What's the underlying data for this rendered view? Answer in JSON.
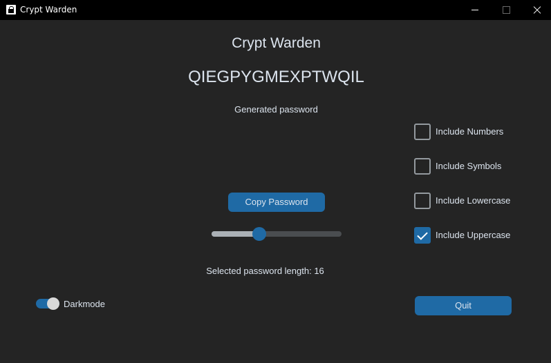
{
  "window": {
    "title": "Crypt Warden",
    "app_icon": "lock-person-icon",
    "controls": [
      "minimize-icon",
      "maximize-icon",
      "close-icon"
    ]
  },
  "main": {
    "title": "Crypt Warden",
    "password": "QIEGPYGMEXPTWQIL",
    "password_caption": "Generated password",
    "copy_label": "Copy Password",
    "length_slider": {
      "value_fraction": 0.35
    },
    "length_label": "Selected password length: 16"
  },
  "options": [
    {
      "label": "Include Numbers",
      "checked": false
    },
    {
      "label": "Include Symbols",
      "checked": false
    },
    {
      "label": "Include Lowercase",
      "checked": false
    },
    {
      "label": "Include Uppercase",
      "checked": true
    }
  ],
  "footer": {
    "darkmode_label": "Darkmode",
    "darkmode_on": true,
    "quit_label": "Quit"
  },
  "colors": {
    "background": "#242424",
    "accent": "#1f6aa5",
    "text": "#dce4ee",
    "titlebar": "#000000"
  }
}
